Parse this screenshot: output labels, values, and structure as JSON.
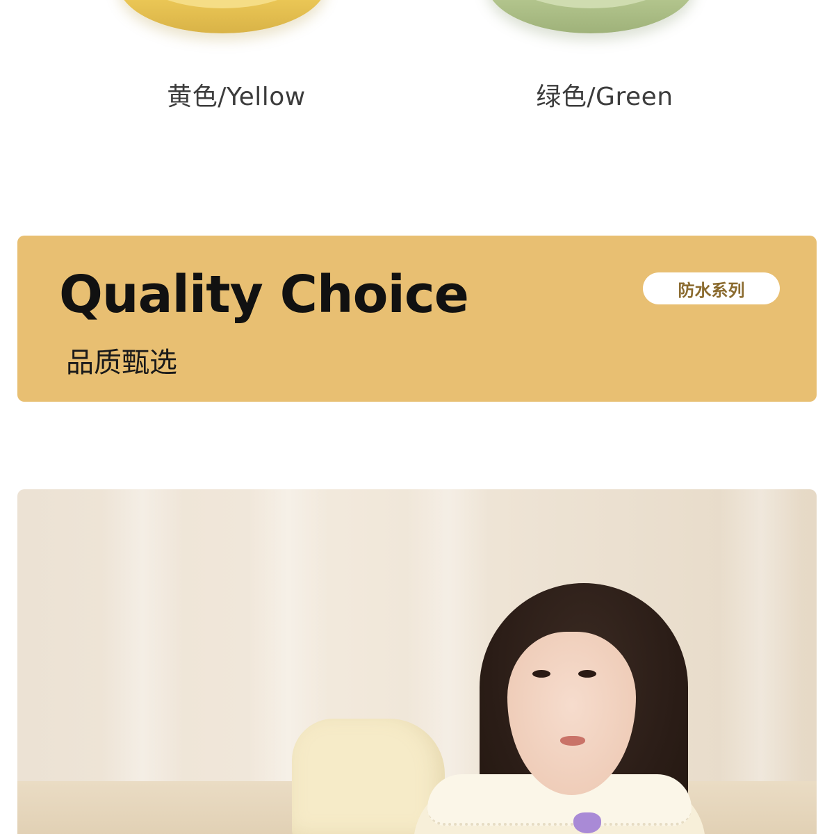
{
  "colors": {
    "page_background": "#ffffff",
    "banner_background": "#e8bf72",
    "title_text": "#111111",
    "badge_background": "#ffffff",
    "badge_text": "#8a6a2e",
    "slipper_yellow": "#ecc857",
    "slipper_green": "#b4c68e"
  },
  "swatches": [
    {
      "label": "黄色/Yellow"
    },
    {
      "label": "绿色/Green"
    }
  ],
  "banner": {
    "title": "Quality Choice",
    "subtitle": "品质甄选",
    "badge": "防水系列"
  }
}
